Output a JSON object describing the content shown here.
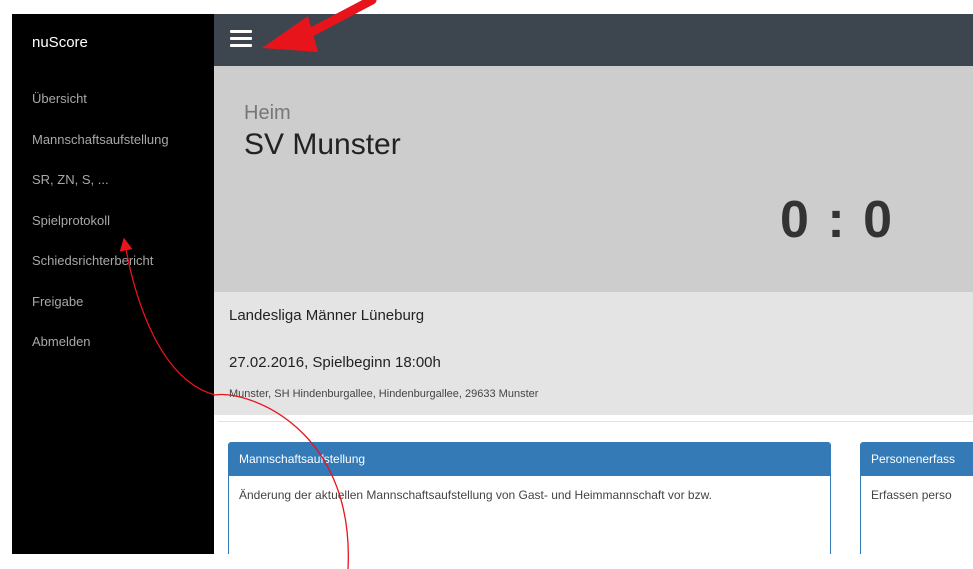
{
  "sidebar": {
    "brand": "nuScore",
    "items": [
      {
        "label": "Übersicht"
      },
      {
        "label": "Mannschaftsaufstellung"
      },
      {
        "label": "SR, ZN, S, ..."
      },
      {
        "label": "Spielprotokoll"
      },
      {
        "label": "Schiedsrichterbericht"
      },
      {
        "label": "Freigabe"
      },
      {
        "label": "Abmelden"
      }
    ]
  },
  "topbar": {
    "menu_icon": "hamburger-menu-icon"
  },
  "match": {
    "home_label": "Heim",
    "home_team": "SV Munster",
    "score": "0 : 0",
    "league": "Landesliga Männer Lüneburg",
    "datetime": "27.02.2016, Spielbeginn 18:00h",
    "venue": "Munster, SH Hindenburgallee, Hindenburgallee, 29633 Munster"
  },
  "cards": [
    {
      "title": "Mannschaftsaufstellung",
      "text": "Änderung der aktuellen Mannschaftsaufstellung von Gast- und Heimmannschaft vor bzw."
    },
    {
      "title": "Personenerfass",
      "text": "Erfassen perso"
    }
  ],
  "colors": {
    "sidebar_bg": "#000000",
    "topbar_bg": "#3d464e",
    "score_panel_bg": "#cdcdcd",
    "info_panel_bg": "#e4e4e4",
    "card_accent": "#337ab7",
    "annotation": "#e8141b"
  }
}
